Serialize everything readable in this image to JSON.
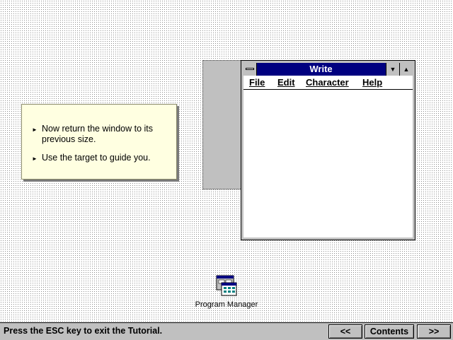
{
  "target": {
    "label": ""
  },
  "window": {
    "title": "Write",
    "menu": [
      "File",
      "Edit",
      "Character",
      "Help"
    ],
    "minimize_glyph": "▼",
    "maximize_glyph": "▲"
  },
  "note": {
    "items": [
      "Now return the window to its previous size.",
      "Use the target to guide you."
    ],
    "bullet": "►"
  },
  "desktop_icon": {
    "label": "Program Manager",
    "icon": "program-manager-icon"
  },
  "bottombar": {
    "message": "Press the ESC key to exit the Tutorial.",
    "prev_label": "<<",
    "contents_label": "Contents",
    "next_label": ">>"
  },
  "colors": {
    "titlebar": "#000080",
    "note_bg": "#ffffe1",
    "chrome": "#c0c0c0"
  }
}
